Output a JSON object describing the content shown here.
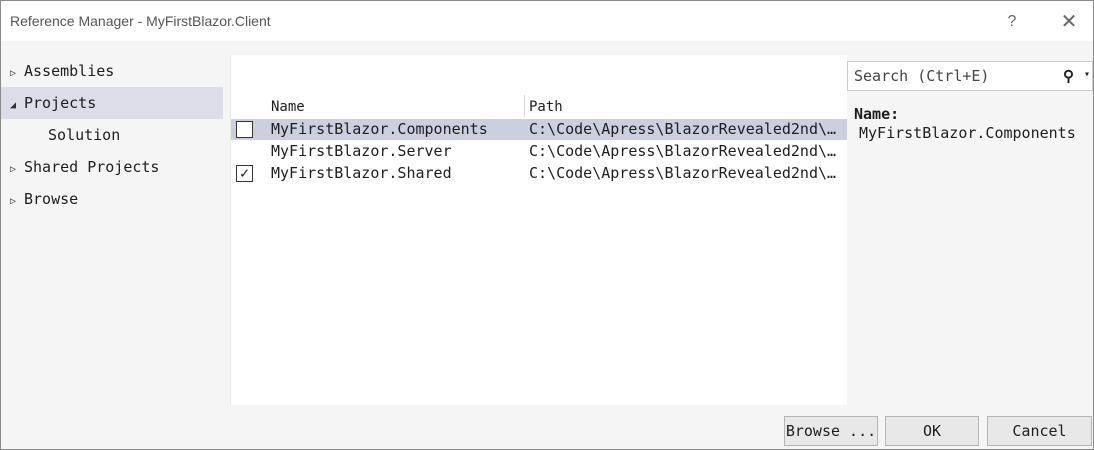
{
  "window": {
    "title": "Reference Manager - MyFirstBlazor.Client",
    "help_label": "?",
    "close_label": "✕"
  },
  "sidebar": {
    "items": [
      {
        "label": "Assemblies",
        "arrow": "▷"
      },
      {
        "label": "Projects",
        "arrow": "◢",
        "selected": true
      },
      {
        "label": "Solution",
        "arrow": ""
      },
      {
        "label": "Shared Projects",
        "arrow": "▷"
      },
      {
        "label": "Browse",
        "arrow": "▷"
      }
    ]
  },
  "table": {
    "columns": {
      "name": "Name",
      "path": "Path"
    },
    "rows": [
      {
        "name": "MyFirstBlazor.Components",
        "path": "C:\\Code\\Apress\\BlazorRevealed2nd\\…",
        "checkbox": true,
        "checked": false,
        "highlighted": true
      },
      {
        "name": "MyFirstBlazor.Server",
        "path": "C:\\Code\\Apress\\BlazorRevealed2nd\\…",
        "checkbox": false,
        "checked": false,
        "highlighted": false
      },
      {
        "name": "MyFirstBlazor.Shared",
        "path": "C:\\Code\\Apress\\BlazorRevealed2nd\\…",
        "checkbox": true,
        "checked": true,
        "highlighted": false
      }
    ]
  },
  "search": {
    "placeholder": "Search (Ctrl+E)",
    "icon": "search-icon"
  },
  "details": {
    "label": "Name:",
    "value": "MyFirstBlazor.Components"
  },
  "footer": {
    "browse_label": "Browse ...",
    "ok_label": "OK",
    "cancel_label": "Cancel"
  },
  "colors": {
    "selection": "#dcdde8",
    "row_highlight": "#cbcfdf",
    "background": "#f5f5f5"
  }
}
